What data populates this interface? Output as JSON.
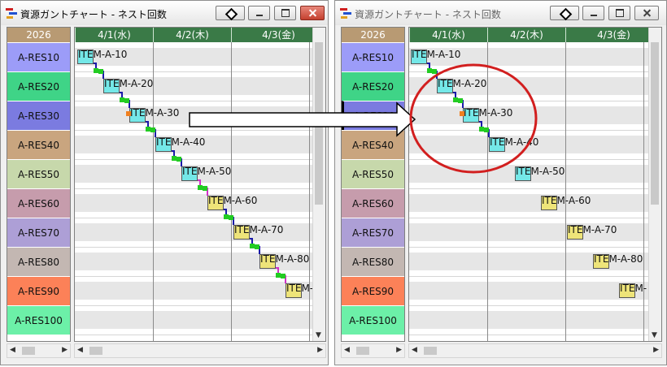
{
  "windows": [
    {
      "title": "資源ガントチャート - ネスト回数",
      "active": true
    },
    {
      "title": "資源ガントチャート - ネスト回数",
      "active": false
    }
  ],
  "year": "2026",
  "days": [
    "4/1(水)",
    "4/2(木)",
    "4/3(金)"
  ],
  "resources": [
    {
      "name": "A-RES10",
      "color": "#9c9cf8"
    },
    {
      "name": "A-RES20",
      "color": "#3fd487"
    },
    {
      "name": "A-RES30",
      "color": "#7b7be0"
    },
    {
      "name": "A-RES40",
      "color": "#c9a57f"
    },
    {
      "name": "A-RES50",
      "color": "#c7d8ab"
    },
    {
      "name": "A-RES60",
      "color": "#c69cac"
    },
    {
      "name": "A-RES70",
      "color": "#ad9fd6"
    },
    {
      "name": "A-RES80",
      "color": "#c3b7b2"
    },
    {
      "name": "A-RES90",
      "color": "#fc8158"
    },
    {
      "name": "A-RES100",
      "color": "#6cf0a8"
    }
  ],
  "items_left": [
    {
      "label": "ITEM-A-10",
      "color": "#74e8e8"
    },
    {
      "label": "ITEM-A-20",
      "color": "#74e8e8"
    },
    {
      "label": "ITEM-A-30",
      "color": "#74e8e8"
    },
    {
      "label": "ITEM-A-40",
      "color": "#74e8e8"
    },
    {
      "label": "ITEM-A-50",
      "color": "#74e8e8"
    },
    {
      "label": "ITEM-A-60",
      "color": "#eee479"
    },
    {
      "label": "ITEM-A-70",
      "color": "#eee479"
    },
    {
      "label": "ITEM-A-80",
      "color": "#eee479"
    },
    {
      "label": "ITEM-",
      "color": "#eee479"
    }
  ],
  "items_right": [
    {
      "label": "ITEM-A-10",
      "color": "#74e8e8"
    },
    {
      "label": "ITEM-A-20",
      "color": "#74e8e8"
    },
    {
      "label": "ITEM-A-30",
      "color": "#74e8e8"
    },
    {
      "label": "ITEM-A-40",
      "color": "#74e8e8"
    },
    {
      "label": "ITEM-A-50",
      "color": "#74e8e8"
    },
    {
      "label": "ITEM-A-60",
      "color": "#eee479"
    },
    {
      "label": "ITEM-A-70",
      "color": "#eee479"
    },
    {
      "label": "ITEM-A-80",
      "color": "#eee479"
    },
    {
      "label": "ITEM-",
      "color": "#eee479"
    }
  ],
  "colors": {
    "link": "#1a1aa8",
    "link_alt": "#d130c8",
    "node": "#22cc22",
    "marker": "#f08020",
    "highlight_circle": "#d21f1f",
    "arrow_fill": "#ffffff"
  }
}
